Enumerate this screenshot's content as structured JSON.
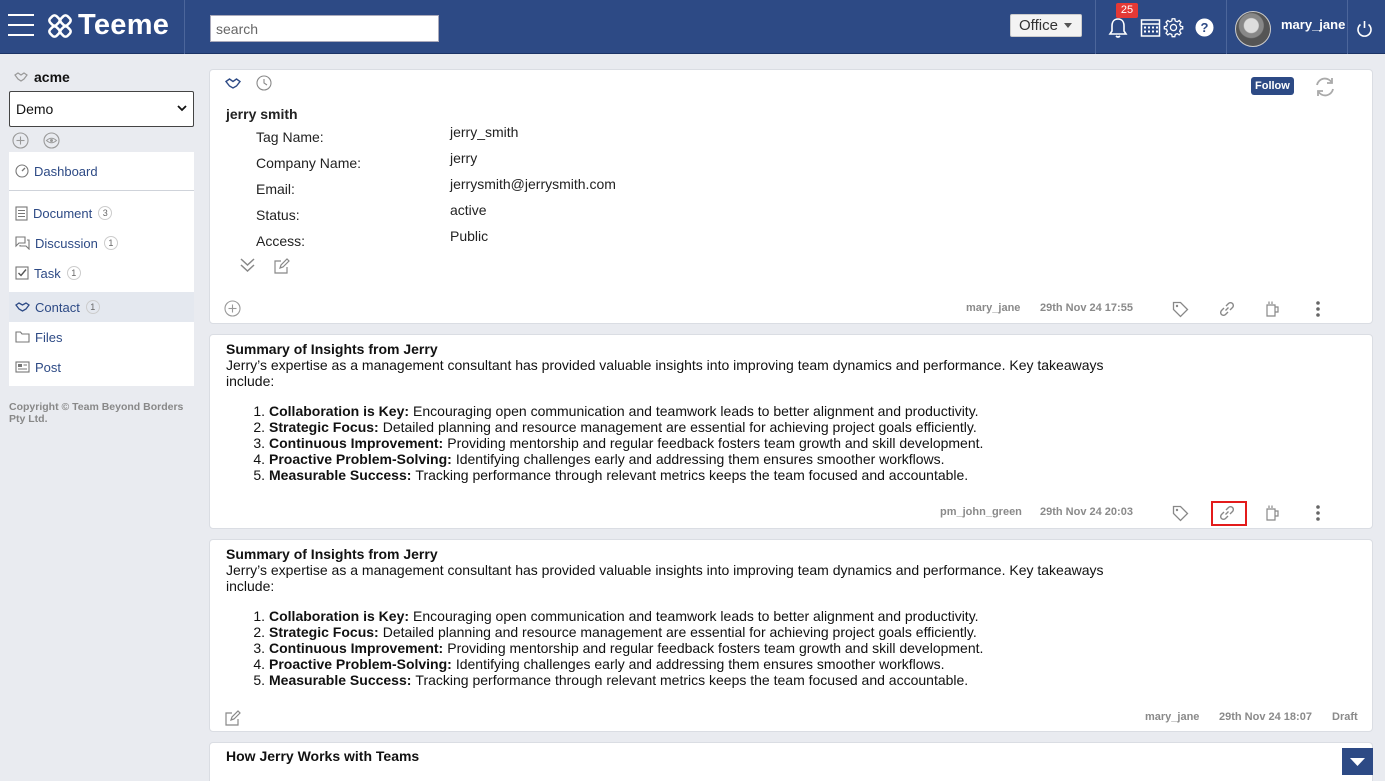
{
  "app": {
    "name": "Teeme"
  },
  "topbar": {
    "search_placeholder": "search",
    "office_label": "Office",
    "notification_count": "25",
    "username": "mary_jane"
  },
  "sidebar": {
    "org_name": "acme",
    "workspace": "Demo",
    "items": [
      {
        "label": "Dashboard",
        "count": "",
        "icon": "dashboard-icon"
      },
      {
        "label": "Document",
        "count": "3",
        "icon": "document-icon"
      },
      {
        "label": "Discussion",
        "count": "1",
        "icon": "discussion-icon"
      },
      {
        "label": "Task",
        "count": "1",
        "icon": "task-icon"
      },
      {
        "label": "Contact",
        "count": "1",
        "icon": "contact-icon"
      },
      {
        "label": "Files",
        "count": "",
        "icon": "folder-icon"
      },
      {
        "label": "Post",
        "count": "",
        "icon": "post-icon"
      }
    ],
    "active": "Contact",
    "copyright": "Copyright © Team Beyond Borders Pty Ltd."
  },
  "contact": {
    "name": "jerry smith",
    "follow_label": "Follow",
    "fields": [
      {
        "label": "Tag Name:",
        "value": "jerry_smith"
      },
      {
        "label": "Company Name:",
        "value": "jerry"
      },
      {
        "label": "Email:",
        "value": "jerrysmith@jerrysmith.com"
      },
      {
        "label": "Status:",
        "value": "active"
      },
      {
        "label": "Access:",
        "value": "Public"
      }
    ],
    "meta_user": "mary_jane",
    "meta_date": "29th Nov 24 17:55"
  },
  "posts": [
    {
      "title": "Summary of Insights from Jerry",
      "intro": "Jerry’s expertise as a management consultant has provided valuable insights into improving team dynamics and performance. Key takeaways include:",
      "items": [
        {
          "num": "1.",
          "head": "Collaboration is Key:",
          "text": "Encouraging open communication and teamwork leads to better alignment and productivity."
        },
        {
          "num": "2.",
          "head": "Strategic Focus:",
          "text": "Detailed planning and resource management are essential for achieving project goals efficiently."
        },
        {
          "num": "3.",
          "head": "Continuous Improvement:",
          "text": "Providing mentorship and regular feedback fosters team growth and skill development."
        },
        {
          "num": "4.",
          "head": "Proactive Problem-Solving:",
          "text": "Identifying challenges early and addressing them ensures smoother workflows."
        },
        {
          "num": "5.",
          "head": "Measurable Success:",
          "text": "Tracking performance through relevant metrics keeps the team focused and accountable."
        }
      ],
      "meta_user": "pm_john_green",
      "meta_date": "29th Nov 24 20:03"
    },
    {
      "title": "Summary of Insights from Jerry",
      "intro": "Jerry’s expertise as a management consultant has provided valuable insights into improving team dynamics and performance. Key takeaways include:",
      "items": [
        {
          "num": "1.",
          "head": "Collaboration is Key:",
          "text": "Encouraging open communication and teamwork leads to better alignment and productivity."
        },
        {
          "num": "2.",
          "head": "Strategic Focus:",
          "text": "Detailed planning and resource management are essential for achieving project goals efficiently."
        },
        {
          "num": "3.",
          "head": "Continuous Improvement:",
          "text": "Providing mentorship and regular feedback fosters team growth and skill development."
        },
        {
          "num": "4.",
          "head": "Proactive Problem-Solving:",
          "text": "Identifying challenges early and addressing them ensures smoother workflows."
        },
        {
          "num": "5.",
          "head": "Measurable Success:",
          "text": "Tracking performance through relevant metrics keeps the team focused and accountable."
        }
      ],
      "meta_user": "mary_jane",
      "meta_date": "29th Nov 24 18:07",
      "status": "Draft"
    },
    {
      "title": "How Jerry Works with Teams"
    }
  ],
  "colors": {
    "brand": "#2d4a85",
    "badge": "#e53935",
    "highlight": "#e31b1b"
  }
}
